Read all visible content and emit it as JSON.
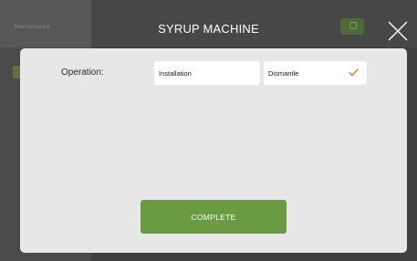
{
  "background": {
    "sidebar_title": "Maintenance"
  },
  "dialog": {
    "title": "SYRUP MACHINE",
    "operation_label": "Operation:",
    "options": [
      {
        "label": "Installation",
        "selected": false
      },
      {
        "label": "Dismantle",
        "selected": true
      }
    ],
    "complete_label": "COMPLETE"
  },
  "icons": {
    "close": "close-icon",
    "check": "check-icon"
  },
  "colors": {
    "accent_green": "#6a9a42",
    "check_orange": "#e58a2e",
    "panel_bg": "#e7e7e7"
  }
}
